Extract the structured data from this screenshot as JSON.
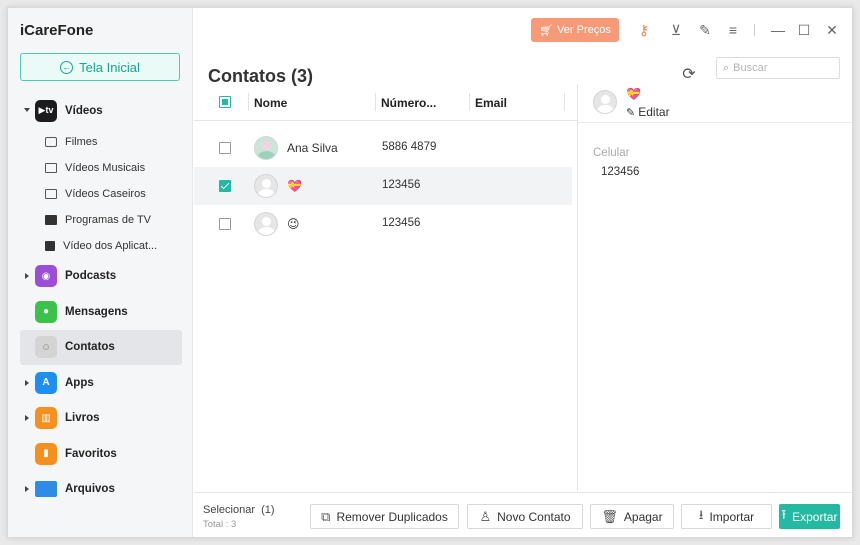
{
  "app": {
    "title": "iCareFone"
  },
  "sidebar": {
    "home_label": "Tela Inicial",
    "items": [
      {
        "label": "Vídeos",
        "icon": "apple-tv-icon",
        "color": "#1c1c1e"
      },
      {
        "label": "Podcasts",
        "icon": "podcasts-icon",
        "color": "#9b4ed8"
      },
      {
        "label": "Mensagens",
        "icon": "messages-icon",
        "color": "#3cc24a"
      },
      {
        "label": "Contatos",
        "icon": "contacts-icon",
        "color": "#c9c9c9"
      },
      {
        "label": "Apps",
        "icon": "app-store-icon",
        "color": "#1e8ff0"
      },
      {
        "label": "Livros",
        "icon": "books-icon",
        "color": "#f5901e"
      },
      {
        "label": "Favoritos",
        "icon": "bookmark-icon",
        "color": "#f5901e"
      },
      {
        "label": "Arquivos",
        "icon": "folder-icon",
        "color": "#2e8ce6"
      }
    ],
    "video_subitems": [
      {
        "label": "Filmes",
        "icon": "film-icon"
      },
      {
        "label": "Vídeos Musicais",
        "icon": "music-video-icon"
      },
      {
        "label": "Vídeos Caseiros",
        "icon": "monitor-icon"
      },
      {
        "label": "Programas de TV",
        "icon": "tv-icon"
      },
      {
        "label": "Vídeo dos Aplicat...",
        "icon": "video-camera-icon"
      }
    ]
  },
  "toolbar": {
    "price_label": "Ver Preços",
    "accent_color": "#f79a77",
    "icons": [
      "key-icon",
      "download-icon",
      "edit-icon",
      "menu-icon",
      "minimize-icon",
      "maximize-icon",
      "close-icon"
    ]
  },
  "main": {
    "title": "Contatos (3)",
    "search_placeholder": "Buscar",
    "columns": [
      "Nome",
      "Número...",
      "Email"
    ],
    "rows": [
      {
        "name": "Ana Silva",
        "number": "5886 4879",
        "email": "",
        "checked": false
      },
      {
        "name": "💝",
        "number": "123456",
        "email": "",
        "checked": true
      },
      {
        "name": "😉",
        "number": "123456",
        "email": "",
        "checked": false
      }
    ]
  },
  "detail": {
    "name": "💝",
    "edit_label": "Editar",
    "field_label": "Celular",
    "field_value": "123456"
  },
  "footer": {
    "select_label": "Selecionar",
    "select_count": "(1)",
    "total_label": "Total : 3",
    "buttons": {
      "remove_duplicates": "Remover Duplicados",
      "new_contact": "Novo Contato",
      "delete": "Apagar",
      "import": "Importar",
      "export": "Exportar"
    },
    "primary_color": "#24b9a3"
  }
}
